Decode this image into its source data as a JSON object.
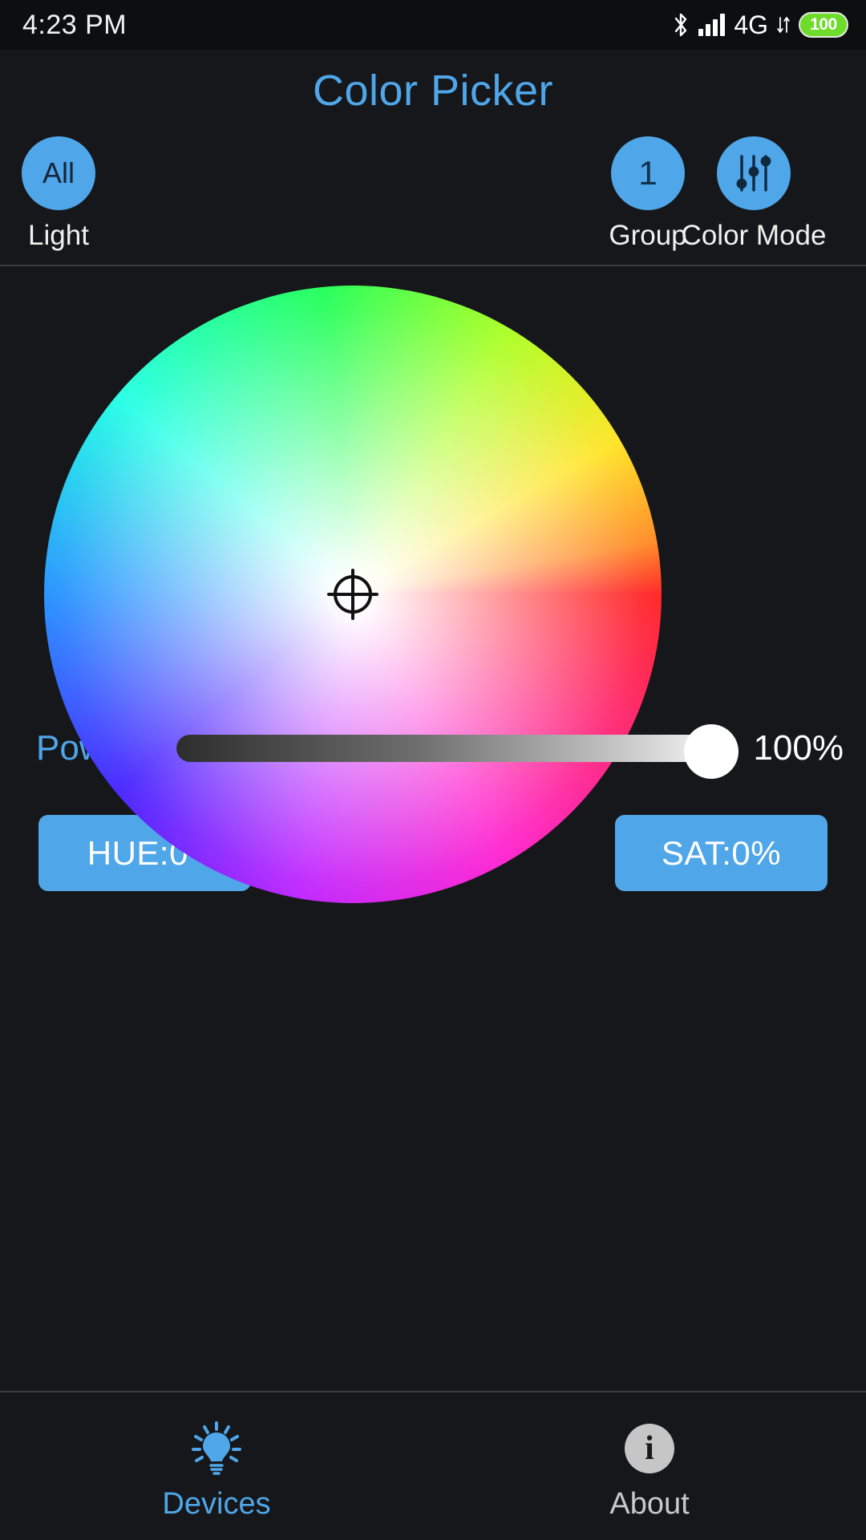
{
  "statusbar": {
    "time": "4:23 PM",
    "bluetooth_icon": "bluetooth-icon",
    "signal_icon": "signal-bars-icon",
    "network": "4G",
    "data_icon": "data-transfer-icon",
    "battery_level": "100",
    "battery_color": "#6ddc2a"
  },
  "header": {
    "title": "Color Picker",
    "accent_color": "#4fa6e8",
    "light_button": {
      "circle_text": "All",
      "label": "Light"
    },
    "group_button": {
      "circle_text": "1",
      "label": "Group"
    },
    "color_mode_button": {
      "icon": "sliders-icon",
      "label": "Color Mode"
    }
  },
  "wheel": {
    "name": "hsv-color-wheel",
    "marker": "crosshair-marker",
    "marker_position": {
      "x_pct": 50,
      "y_pct": 50
    }
  },
  "power": {
    "label": "Power",
    "value": "100%",
    "percent": 100
  },
  "values": {
    "hue": "HUE:0°",
    "saturation": "SAT:0%"
  },
  "bottomnav": {
    "devices": {
      "label": "Devices",
      "icon": "lightbulb-icon",
      "active": true
    },
    "about": {
      "label": "About",
      "icon": "info-icon",
      "active": false
    }
  }
}
